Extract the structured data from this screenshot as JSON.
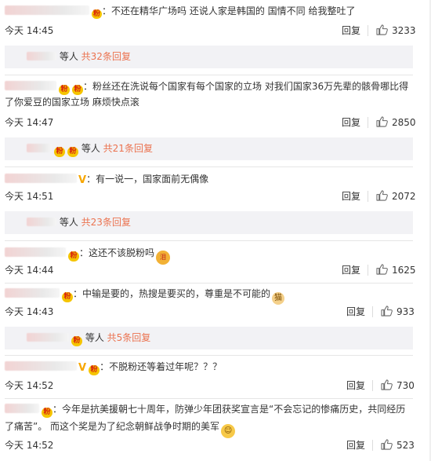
{
  "reply_label": "回复",
  "comments": [
    {
      "text": "：不还在精华广场吗 还说人家是韩国的 国情不同 给我整吐了",
      "time": "今天 14:45",
      "likes": "3233",
      "sub": {
        "pre": "等人",
        "count": "共32条回复"
      }
    },
    {
      "text_line1": "：粉丝还在洗说每个国家有每个国家的立场 对我们国家36万先辈的骸骨哪比得",
      "text_line2": "了你爱豆的国家立场 麻烦快点滚",
      "time": "今天 14:47",
      "likes": "2850",
      "sub": {
        "pre": "等人",
        "count": "共21条回复"
      }
    },
    {
      "text": "：有一说一，国家面前无偶像",
      "time": "今天 14:51",
      "likes": "2072",
      "sub": {
        "pre": "等人",
        "count": "共23条回复"
      }
    },
    {
      "text": "：这还不该脱粉吗",
      "time": "今天 14:44",
      "likes": "1625"
    },
    {
      "text": "：中输是要的，热搜是要买的，尊重是不可能的",
      "time": "今天 14:43",
      "likes": "933",
      "sub": {
        "pre": "等人",
        "count": "共5条回复"
      }
    },
    {
      "text": "：不脱粉还等着过年呢？？？",
      "time": "今天 14:52",
      "likes": "730"
    },
    {
      "text_line1": "：今年是抗美援朝七十周年，防弹少年团获奖宣言是“不会忘记的惨痛历史，共同经历",
      "text_line2": "了痛苦”。 而这个奖是为了纪念朝鲜战争时期的美军",
      "time": "今天 14:52",
      "likes": "523"
    }
  ],
  "icons": {
    "like": "thumbs-up-icon",
    "badge": "fan-badge-icon",
    "verified": "verified-v-icon"
  },
  "colors": {
    "accent": "#eb7350",
    "badge": "#f5c400",
    "verified": "#f7a600",
    "subbox_bg": "#f2f2f5"
  }
}
